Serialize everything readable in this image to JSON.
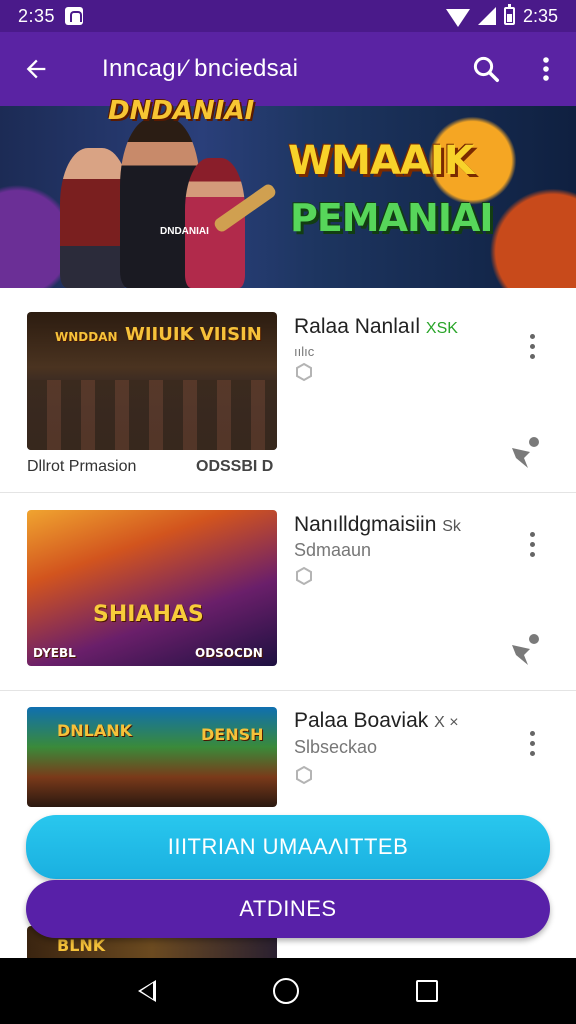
{
  "status_bar": {
    "time_left": "2:35",
    "time_right": "2:35"
  },
  "toolbar": {
    "title": "Inncagı⁄ bnciedsai"
  },
  "hero": {
    "left_logo": "DNDANIAI",
    "left_logo_sub": "DNDANIAI",
    "title_line_1": "WMAAIK",
    "title_line_2": "PEMANIAI"
  },
  "items": [
    {
      "title": "Ralaa Nanlaıl",
      "tag": "XSK",
      "subtitle": "ıılıc",
      "thumb_label": "WIIUIK VIISIN",
      "thumb_label_left": "WNDDAN",
      "caption_left": "Dllrot Prmasion",
      "caption_right": "ODSSBI D"
    },
    {
      "title": "Nanılldgmaisiin",
      "tag": "Sk",
      "subtitle": "Sdmaaun",
      "thumb_label": "SHIAHAS",
      "thumb_label_left": "DYEBL",
      "caption_right": "ODSOCDN"
    },
    {
      "title": "Palaa Boaviak",
      "tag": "X ×",
      "subtitle": "Slbseckao",
      "thumb_label": "DENSH",
      "thumb_label_left": "DNLANK"
    }
  ],
  "buttons": {
    "primary": "IIITRIAN UMAAΛITTEB",
    "secondary": "ATDINES"
  },
  "peek_label": "BLNK",
  "colors": {
    "status_bar": "#4a1a8a",
    "toolbar": "#5a23a3",
    "primary_button": "#1ab0e0",
    "secondary_button": "#5820a8"
  }
}
